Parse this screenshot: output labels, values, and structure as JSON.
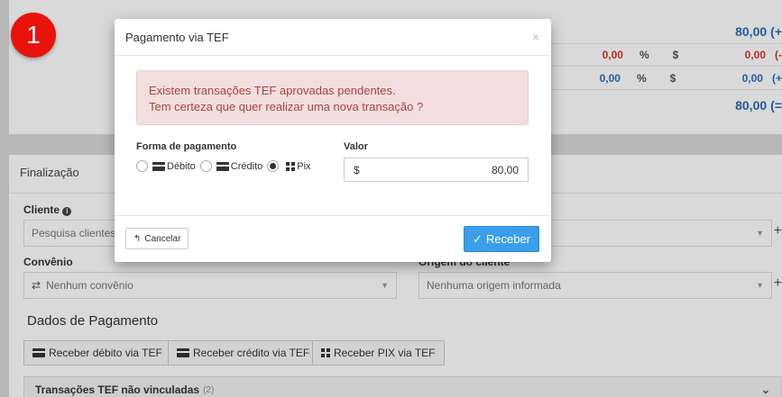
{
  "badge": "1",
  "summary": {
    "row1": {
      "value": "80,00",
      "suffix": "(+"
    },
    "row2": {
      "left": "0,00",
      "pct": "%",
      "cur": "$",
      "right": "0,00",
      "suffix": "(-"
    },
    "row3": {
      "left": "0,00",
      "pct": "%",
      "cur": "$",
      "right": "0,00",
      "suffix": "(+"
    },
    "row4": {
      "value": "80,00",
      "suffix": "(="
    }
  },
  "finalizacao": {
    "title": "Finalização",
    "cliente_label": "Cliente",
    "cliente_placeholder": "Pesquisa clientes",
    "convenio_label": "Convênio",
    "convenio_value": "Nenhum convênio",
    "origem_label": "Origem do cliente",
    "origem_value": "Nenhuma origem informada"
  },
  "pagamento": {
    "title": "Dados de Pagamento",
    "btn_debito": "Receber débito via TEF",
    "btn_credito": "Receber crédito via TEF",
    "btn_pix": "Receber PIX via TEF",
    "tef_bar": "Transações TEF não vinculadas",
    "tef_count": "(2)"
  },
  "modal": {
    "title": "Pagamento via TEF",
    "close": "×",
    "alert_line1": "Existem transações TEF aprovadas pendentes.",
    "alert_line2": "Tem certeza que quer realizar uma nova transação ?",
    "forma_label": "Forma de pagamento",
    "opt_debito": "Débito",
    "opt_credito": "Crédito",
    "opt_pix": "Pix",
    "selected": "pix",
    "valor_label": "Valor",
    "valor_currency": "$",
    "valor_value": "80,00",
    "cancel": "Cancelar",
    "receber": "Receber"
  },
  "colors": {
    "accent": "#3a9ee8",
    "alert_bg": "#f2dede",
    "alert_text": "#a94442",
    "badge": "#e8130c"
  }
}
